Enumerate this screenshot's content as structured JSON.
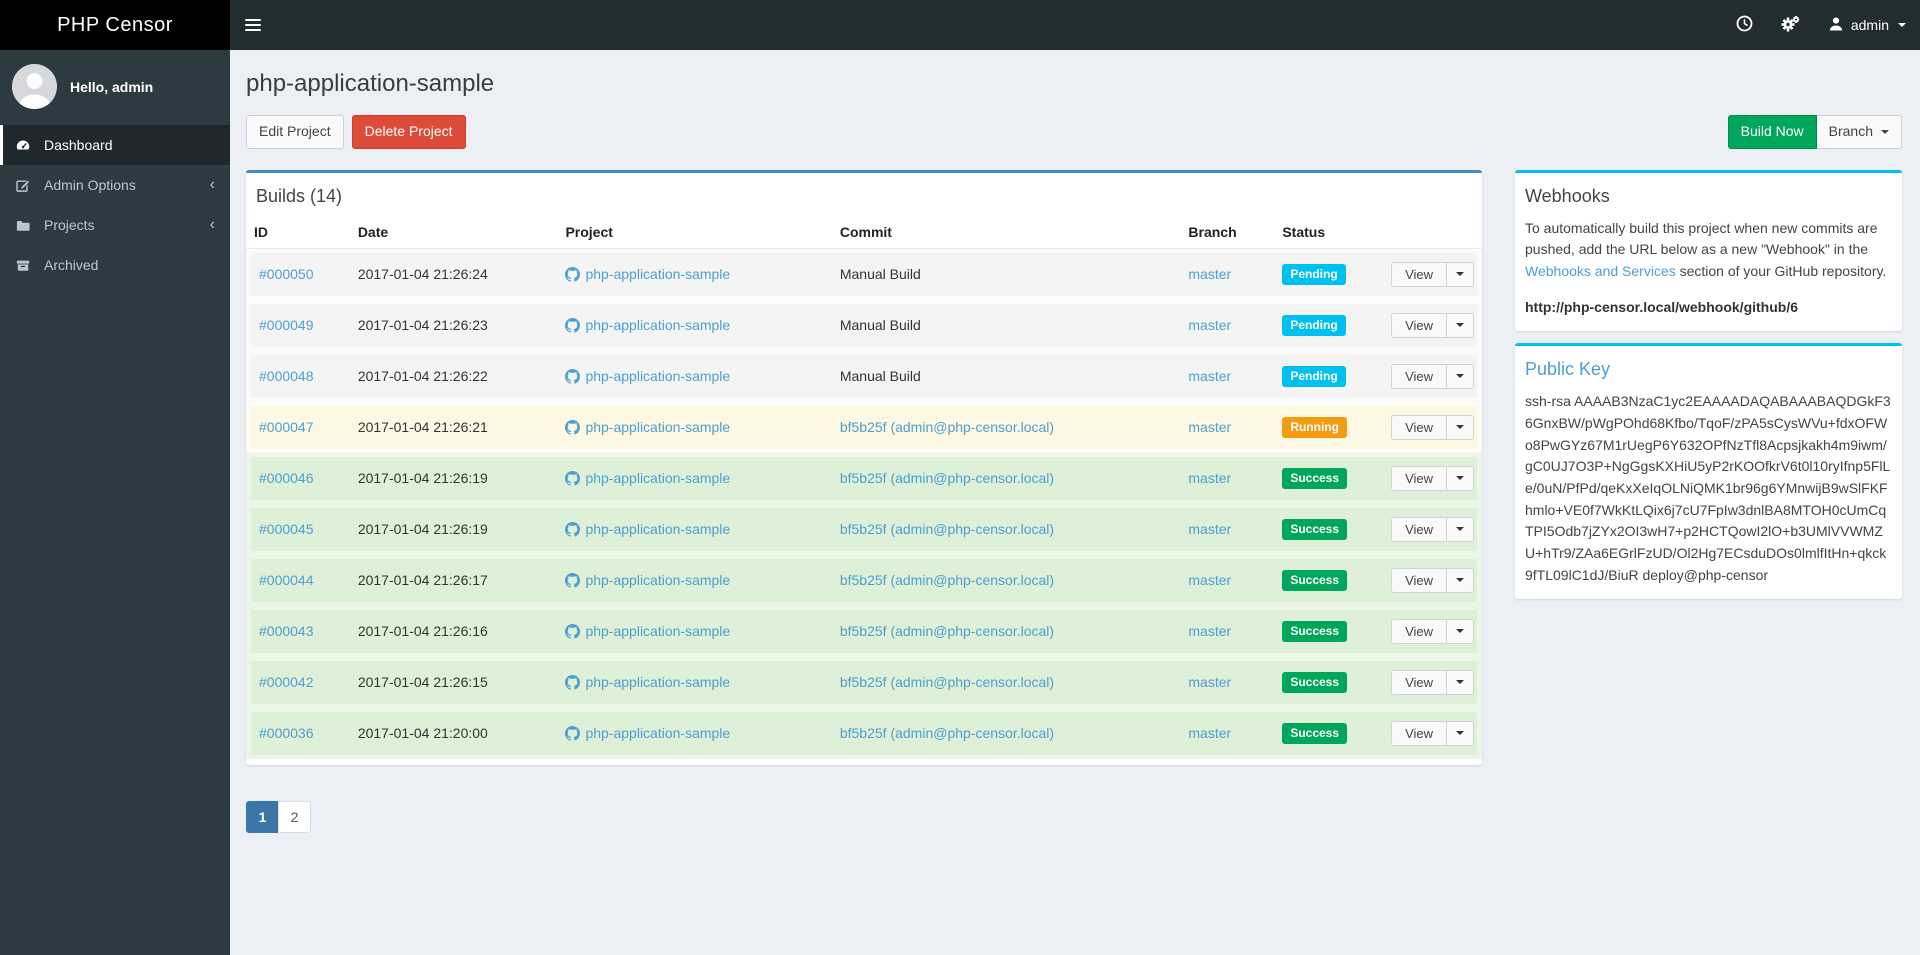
{
  "app": {
    "title": "PHP Censor"
  },
  "navbar": {
    "user_label": "admin",
    "icons": {
      "menu": "hamburger",
      "builds_queue": "clock",
      "settings": "cogs",
      "account": "user-silhouette",
      "expand": "caret-down"
    }
  },
  "sidebar": {
    "greeting": "Hello, admin",
    "items": [
      {
        "label": "Dashboard",
        "icon": "dashboard-gauge",
        "active": true,
        "has_chevron": false
      },
      {
        "label": "Admin Options",
        "icon": "pencil-square",
        "active": false,
        "has_chevron": true
      },
      {
        "label": "Projects",
        "icon": "folder",
        "active": false,
        "has_chevron": true
      },
      {
        "label": "Archived",
        "icon": "archive-box",
        "active": false,
        "has_chevron": false
      }
    ],
    "chevron_glyph": "‹"
  },
  "page": {
    "title": "php-application-sample"
  },
  "toolbar": {
    "edit_label": "Edit Project",
    "delete_label": "Delete Project",
    "build_now_label": "Build Now",
    "branch_label": "Branch"
  },
  "builds": {
    "title": "Builds (14)",
    "columns": [
      "ID",
      "Date",
      "Project",
      "Commit",
      "Branch",
      "Status",
      ""
    ],
    "view_label": "View",
    "statuses": {
      "Pending": {
        "label": "Pending",
        "badge": "#00c0ef",
        "row": "#f4f4f4",
        "gap": "#fbfbfb"
      },
      "Running": {
        "label": "Running",
        "badge": "#f39c12",
        "row": "#fcf8e3",
        "gap": "#fefcf3"
      },
      "Success": {
        "label": "Success",
        "badge": "#00a65a",
        "row": "#dff0d8",
        "gap": "#ecf6e6"
      }
    },
    "rows": [
      {
        "id": "#000050",
        "date": "2017-01-04 21:26:24",
        "project": "php-application-sample",
        "commit": "Manual Build",
        "commit_is_link": false,
        "branch": "master",
        "status": "Pending"
      },
      {
        "id": "#000049",
        "date": "2017-01-04 21:26:23",
        "project": "php-application-sample",
        "commit": "Manual Build",
        "commit_is_link": false,
        "branch": "master",
        "status": "Pending"
      },
      {
        "id": "#000048",
        "date": "2017-01-04 21:26:22",
        "project": "php-application-sample",
        "commit": "Manual Build",
        "commit_is_link": false,
        "branch": "master",
        "status": "Pending"
      },
      {
        "id": "#000047",
        "date": "2017-01-04 21:26:21",
        "project": "php-application-sample",
        "commit": "bf5b25f (admin@php-censor.local)",
        "commit_is_link": true,
        "branch": "master",
        "status": "Running"
      },
      {
        "id": "#000046",
        "date": "2017-01-04 21:26:19",
        "project": "php-application-sample",
        "commit": "bf5b25f (admin@php-censor.local)",
        "commit_is_link": true,
        "branch": "master",
        "status": "Success"
      },
      {
        "id": "#000045",
        "date": "2017-01-04 21:26:19",
        "project": "php-application-sample",
        "commit": "bf5b25f (admin@php-censor.local)",
        "commit_is_link": true,
        "branch": "master",
        "status": "Success"
      },
      {
        "id": "#000044",
        "date": "2017-01-04 21:26:17",
        "project": "php-application-sample",
        "commit": "bf5b25f (admin@php-censor.local)",
        "commit_is_link": true,
        "branch": "master",
        "status": "Success"
      },
      {
        "id": "#000043",
        "date": "2017-01-04 21:26:16",
        "project": "php-application-sample",
        "commit": "bf5b25f (admin@php-censor.local)",
        "commit_is_link": true,
        "branch": "master",
        "status": "Success"
      },
      {
        "id": "#000042",
        "date": "2017-01-04 21:26:15",
        "project": "php-application-sample",
        "commit": "bf5b25f (admin@php-censor.local)",
        "commit_is_link": true,
        "branch": "master",
        "status": "Success"
      },
      {
        "id": "#000036",
        "date": "2017-01-04 21:20:00",
        "project": "php-application-sample",
        "commit": "bf5b25f (admin@php-censor.local)",
        "commit_is_link": true,
        "branch": "master",
        "status": "Success"
      }
    ]
  },
  "pagination": {
    "pages": [
      "1",
      "2"
    ],
    "active": "1"
  },
  "webhooks": {
    "title": "Webhooks",
    "text_before": "To automatically build this project when new commits are pushed, add the URL below as a new \"Webhook\" in the ",
    "link_label": "Webhooks and Services",
    "text_after": " section of your GitHub repository.",
    "url": "http://php-censor.local/webhook/github/6"
  },
  "public_key": {
    "title": "Public Key",
    "key": "ssh-rsa AAAAB3NzaC1yc2EAAAADAQABAAABAQDGkF36GnxBW/pWgPOhd68Kfbo/TqoF/zPA5sCysWVu+fdxOFWo8PwGYz67M1rUegP6Y632OPfNzTfl8Acpsjkakh4m9iwm/gC0UJ7O3P+NgGgsKXHiU5yP2rKOOfkrV6t0l10ryIfnp5FlLe/0uN/PfPd/qeKxXeIqOLNiQMK1br96g6YMnwijB9wSlFKFhmlo+VE0f7WkKtLQix6j7cU7FpIw3dnlBA8MTOH0cUmCqTPI5Odb7jZYx2OI3wH7+p2HCTQowI2lO+b3UMlVVWMZU+hTr9/ZAa6EGrlFzUD/Ol2Hg7ECsduDOs0lmlfItHn+qkck9fTL09lC1dJ/BiuR deploy@php-censor"
  },
  "colors": {
    "navbar_bg": "#222d32",
    "logo_bg": "#000000",
    "sidebar_bg": "#2e3a41",
    "sidebar_active_bg": "#1f282d",
    "page_bg": "#ecf0f5",
    "link": "#4da0cf",
    "panel_primary_border": "#3c8dbc",
    "panel_info_border": "#00c0ef",
    "danger": "#dd4b39",
    "success": "#00a65a",
    "pagination_active": "#3a76a8"
  }
}
